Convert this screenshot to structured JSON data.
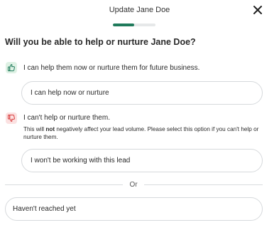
{
  "header": {
    "title": "Update Jane Doe",
    "close_icon": "close-icon"
  },
  "progress": {
    "current_step": 1,
    "total_steps": 2
  },
  "question": "Will you be able to help or nurture Jane Doe?",
  "options": {
    "help": {
      "icon": "thumbs-up-icon",
      "label": "I can help them now or nurture them for future business.",
      "button_label": "I can help now or nurture"
    },
    "cannot_help": {
      "icon": "thumbs-down-icon",
      "label": "I can't help or nurture them.",
      "note_before": "This will ",
      "note_bold": "not",
      "note_after": " negatively affect your lead volume. Please select this option if you can't help or nurture them.",
      "button_label": "I won't be working with this lead"
    }
  },
  "divider_label": "Or",
  "not_reached_button": "Haven't reached yet",
  "colors": {
    "accent": "#1f7a5b",
    "positive_bg": "#def1e4",
    "negative_bg": "#fbe1e1",
    "negative_icon": "#d93a3a",
    "border": "#d6d9dc"
  }
}
